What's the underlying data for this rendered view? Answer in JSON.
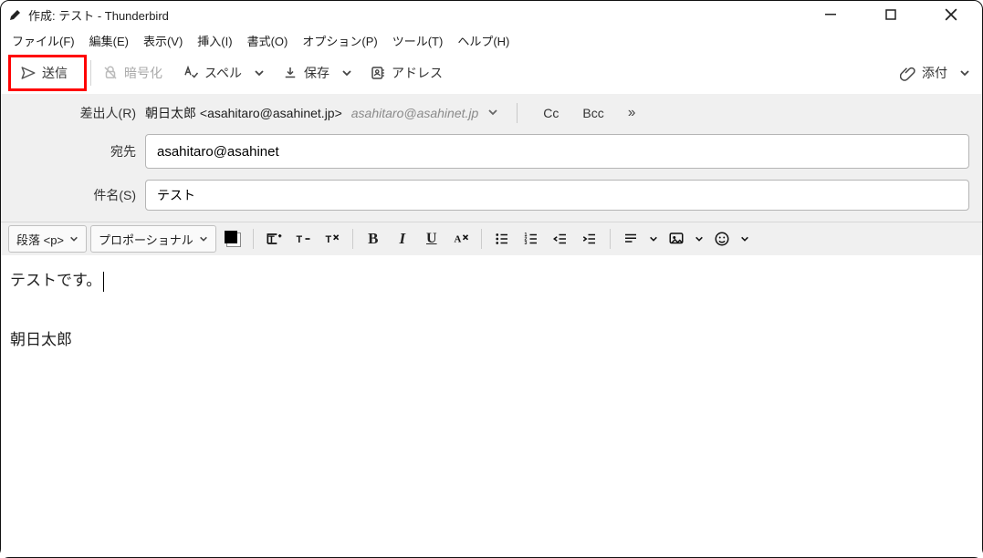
{
  "window": {
    "title": "作成: テスト - Thunderbird"
  },
  "menus": {
    "file": "ファイル(F)",
    "edit": "編集(E)",
    "view": "表示(V)",
    "insert": "挿入(I)",
    "format": "書式(O)",
    "options": "オプション(P)",
    "tools": "ツール(T)",
    "help": "ヘルプ(H)"
  },
  "toolbar": {
    "send": "送信",
    "encrypt": "暗号化",
    "spell": "スペル",
    "save": "保存",
    "address": "アドレス",
    "attach": "添付"
  },
  "headers": {
    "from_label": "差出人(R)",
    "from_value": "朝日太郎 <asahitaro@asahinet.jp>",
    "from_identity_extra": "asahitaro@asahinet.jp",
    "cc": "Cc",
    "bcc": "Bcc",
    "to_label": "宛先",
    "to_value": "asahitaro@asahinet",
    "subject_label": "件名(S)",
    "subject_value": "テスト"
  },
  "format": {
    "block": "段落 <p>",
    "font": "プロポーショナル"
  },
  "body": {
    "line1": "テストです。",
    "line2": "朝日太郎"
  }
}
